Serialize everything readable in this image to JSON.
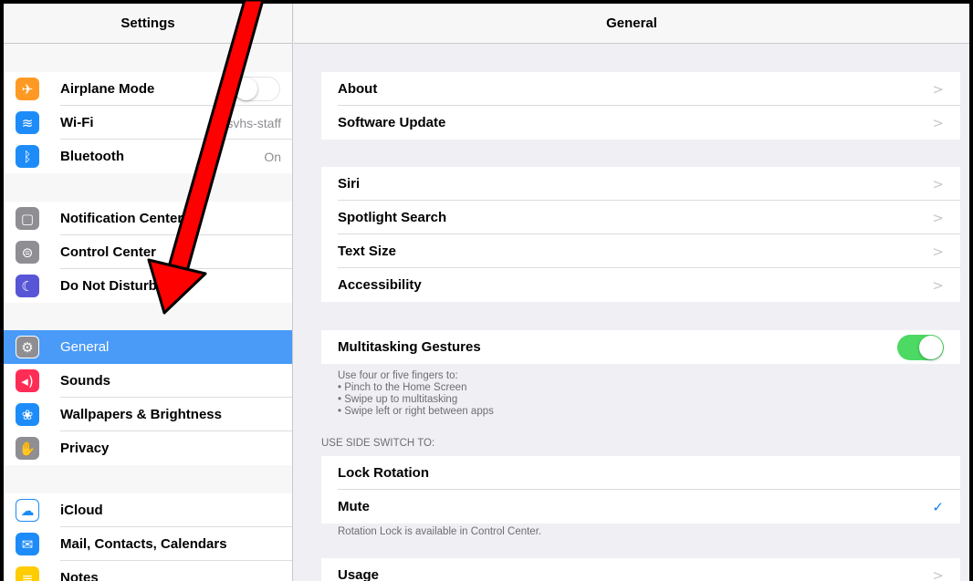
{
  "left": {
    "title": "Settings",
    "groups": [
      [
        {
          "label": "Airplane Mode",
          "icon": "airplane-icon",
          "color": "#fe9a24",
          "glyph": "✈",
          "value": ""
        },
        {
          "label": "Wi-Fi",
          "icon": "wifi-icon",
          "color": "#1d8cf8",
          "glyph": "≋",
          "value": "svhs-staff"
        },
        {
          "label": "Bluetooth",
          "icon": "bluetooth-icon",
          "color": "#1d8cf8",
          "glyph": "ᛒ",
          "value": "On"
        }
      ],
      [
        {
          "label": "Notification Center",
          "icon": "notification-center-icon",
          "color": "#8e8e93",
          "glyph": "▢"
        },
        {
          "label": "Control Center",
          "icon": "control-center-icon",
          "color": "#8e8e93",
          "glyph": "⊜"
        },
        {
          "label": "Do Not Disturb",
          "icon": "moon-icon",
          "color": "#5856d6",
          "glyph": "☾"
        }
      ],
      [
        {
          "label": "General",
          "icon": "gear-icon",
          "color": "#8e8e93",
          "glyph": "⚙"
        },
        {
          "label": "Sounds",
          "icon": "speaker-icon",
          "color": "#ff2d55",
          "glyph": "◂)"
        },
        {
          "label": "Wallpapers & Brightness",
          "icon": "flower-icon",
          "color": "#1d8cf8",
          "glyph": "❀"
        },
        {
          "label": "Privacy",
          "icon": "hand-icon",
          "color": "#8e8e93",
          "glyph": "✋"
        }
      ],
      [
        {
          "label": "iCloud",
          "icon": "cloud-icon",
          "color": "#ffffff",
          "glyph": "☁"
        },
        {
          "label": "Mail, Contacts, Calendars",
          "icon": "mail-icon",
          "color": "#1d8cf8",
          "glyph": "✉"
        },
        {
          "label": "Notes",
          "icon": "notes-icon",
          "color": "#ffcc00",
          "glyph": "≡"
        }
      ]
    ]
  },
  "right": {
    "title": "General",
    "group1": [
      "About",
      "Software Update"
    ],
    "group2": [
      "Siri",
      "Spotlight Search",
      "Text Size",
      "Accessibility"
    ],
    "multitasking": "Multitasking Gestures",
    "multitasking_on": true,
    "multitasking_note": [
      "Use four or five fingers to:",
      "• Pinch to the Home Screen",
      "• Swipe up to multitasking",
      "• Swipe left or right between apps"
    ],
    "side_switch_header": "USE SIDE SWITCH TO:",
    "side_switch": [
      "Lock Rotation",
      "Mute"
    ],
    "side_switch_selected": "Mute",
    "rotation_note": "Rotation Lock is available in Control Center.",
    "usage": "Usage"
  },
  "colors": {
    "selected": "#4a9bf7",
    "toggle_on": "#4cd964",
    "annotation_arrow": "#ff0000"
  }
}
